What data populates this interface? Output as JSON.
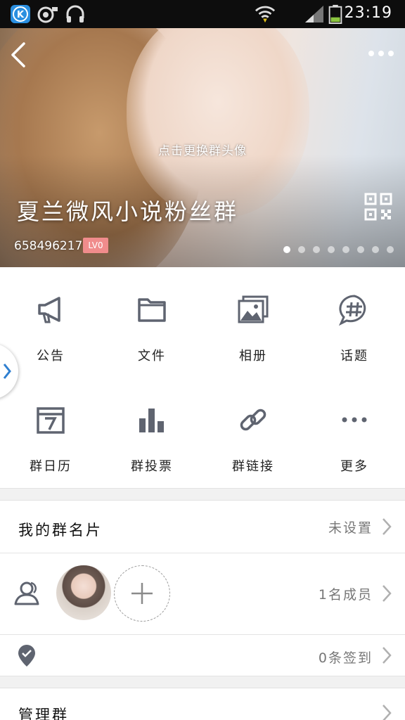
{
  "status_bar": {
    "time": "23:19"
  },
  "header": {
    "change_avatar_hint": "点击更换群头像",
    "group_name": "夏兰微风小说粉丝群",
    "group_id": "658496217",
    "level": "LV0",
    "banner_page_count": 8,
    "banner_active_index": 0
  },
  "grid": {
    "items": [
      {
        "label": "公告",
        "icon": "megaphone-icon"
      },
      {
        "label": "文件",
        "icon": "folder-icon"
      },
      {
        "label": "相册",
        "icon": "album-icon"
      },
      {
        "label": "话题",
        "icon": "topic-icon"
      },
      {
        "label": "群日历",
        "icon": "calendar-icon"
      },
      {
        "label": "群投票",
        "icon": "vote-chart-icon"
      },
      {
        "label": "群链接",
        "icon": "link-icon"
      },
      {
        "label": "更多",
        "icon": "more-dots-icon"
      }
    ]
  },
  "my_card": {
    "title": "我的群名片",
    "value": "未设置"
  },
  "members": {
    "count_text": "1名成员"
  },
  "checkin": {
    "value": "0条签到"
  },
  "manage": {
    "title": "管理群"
  },
  "colors": {
    "icon_gray": "#5f6470",
    "badge": "#f08c8c",
    "chevron": "#b0b0b0"
  }
}
